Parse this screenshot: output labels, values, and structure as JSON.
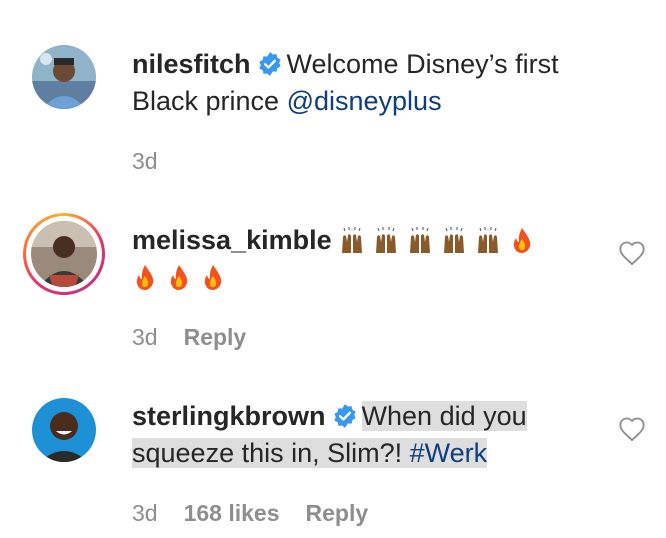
{
  "comments": [
    {
      "username": "nilesfitch",
      "verified": true,
      "text_parts": [
        "Welcome Disney’s first",
        "Black prince "
      ],
      "mention": "@disneyplus",
      "time": "3d"
    },
    {
      "username": "melissa_kimble",
      "verified": false,
      "emoji_line1": [
        "raising-hands",
        "raising-hands",
        "raising-hands",
        "raising-hands",
        "raising-hands",
        "fire"
      ],
      "emoji_line2": [
        "fire",
        "fire",
        "fire"
      ],
      "time": "3d",
      "reply": "Reply"
    },
    {
      "username": "sterlingkbrown",
      "verified": true,
      "text_line1": "When did you",
      "text_line2": "squeeze this in, Slim?! ",
      "hashtag": "#Werk",
      "time": "3d",
      "likes": "168 likes",
      "reply": "Reply"
    }
  ],
  "colors": {
    "text": "#262626",
    "meta": "#8e8e8e",
    "link": "#0e3d80",
    "verified": "#3897f0",
    "highlight": "#dedede"
  }
}
